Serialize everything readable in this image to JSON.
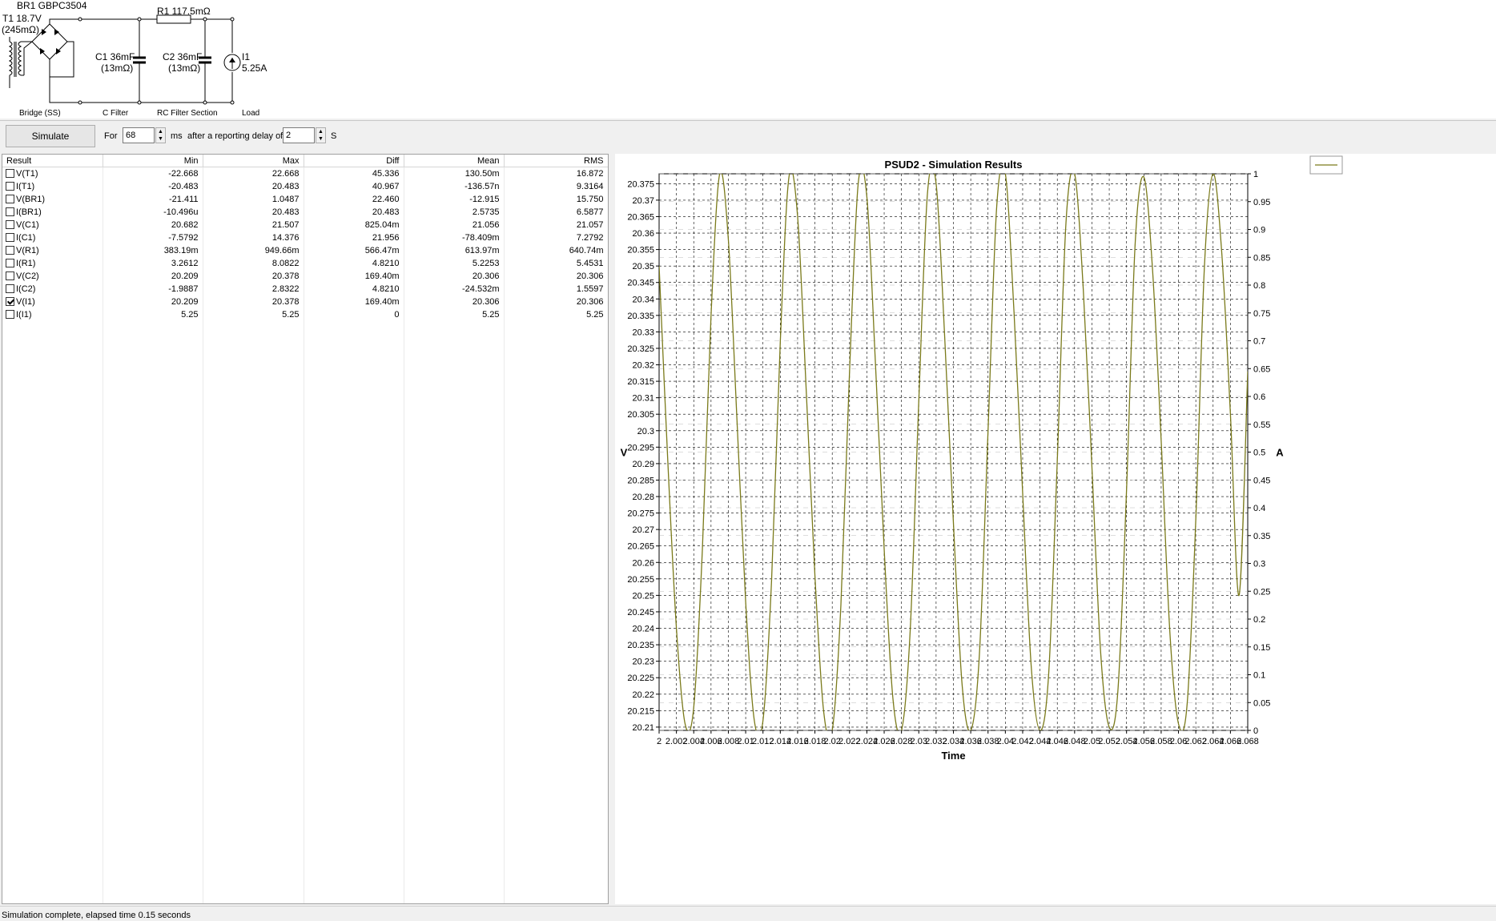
{
  "circuit": {
    "br1": "BR1 GBPC3504",
    "r1": "R1 117.5mΩ",
    "t1_line1": "T1 18.7V",
    "t1_line2": "(245mΩ)",
    "c1_line1": "C1 36mF",
    "c1_line2": "(13mΩ)",
    "c2_line1": "C2 36mF",
    "c2_line2": "(13mΩ)",
    "i1_line1": "I1",
    "i1_line2": "5.25A",
    "sections": [
      "Bridge (SS)",
      "C Filter",
      "RC Filter Section",
      "Load"
    ]
  },
  "controls": {
    "simulate_label": "Simulate",
    "for_label": "For",
    "duration_value": "68",
    "ms_label": "ms",
    "delay_label": "after a reporting delay of",
    "delay_value": "2",
    "s_label": "S"
  },
  "table": {
    "headers": [
      "Result",
      "Min",
      "Max",
      "Diff",
      "Mean",
      "RMS"
    ],
    "rows": [
      {
        "name": "V(T1)",
        "checked": false,
        "min": "-22.668",
        "max": "22.668",
        "diff": "45.336",
        "mean": "130.50m",
        "rms": "16.872"
      },
      {
        "name": "I(T1)",
        "checked": false,
        "min": "-20.483",
        "max": "20.483",
        "diff": "40.967",
        "mean": "-136.57n",
        "rms": "9.3164"
      },
      {
        "name": "V(BR1)",
        "checked": false,
        "min": "-21.411",
        "max": "1.0487",
        "diff": "22.460",
        "mean": "-12.915",
        "rms": "15.750"
      },
      {
        "name": "I(BR1)",
        "checked": false,
        "min": "-10.496u",
        "max": "20.483",
        "diff": "20.483",
        "mean": "2.5735",
        "rms": "6.5877"
      },
      {
        "name": "V(C1)",
        "checked": false,
        "min": "20.682",
        "max": "21.507",
        "diff": "825.04m",
        "mean": "21.056",
        "rms": "21.057"
      },
      {
        "name": "I(C1)",
        "checked": false,
        "min": "-7.5792",
        "max": "14.376",
        "diff": "21.956",
        "mean": "-78.409m",
        "rms": "7.2792"
      },
      {
        "name": "V(R1)",
        "checked": false,
        "min": "383.19m",
        "max": "949.66m",
        "diff": "566.47m",
        "mean": "613.97m",
        "rms": "640.74m"
      },
      {
        "name": "I(R1)",
        "checked": false,
        "min": "3.2612",
        "max": "8.0822",
        "diff": "4.8210",
        "mean": "5.2253",
        "rms": "5.4531"
      },
      {
        "name": "V(C2)",
        "checked": false,
        "min": "20.209",
        "max": "20.378",
        "diff": "169.40m",
        "mean": "20.306",
        "rms": "20.306"
      },
      {
        "name": "I(C2)",
        "checked": false,
        "min": "-1.9887",
        "max": "2.8322",
        "diff": "4.8210",
        "mean": "-24.532m",
        "rms": "1.5597"
      },
      {
        "name": "V(I1)",
        "checked": true,
        "min": "20.209",
        "max": "20.378",
        "diff": "169.40m",
        "mean": "20.306",
        "rms": "20.306"
      },
      {
        "name": "I(I1)",
        "checked": false,
        "min": "5.25",
        "max": "5.25",
        "diff": "0",
        "mean": "5.25",
        "rms": "5.25"
      }
    ]
  },
  "chart_data": {
    "type": "line",
    "title": "PSUD2 - Simulation Results",
    "xlabel": "Time",
    "ylabel": "V",
    "y2label": "A",
    "xlim": [
      2,
      2.068
    ],
    "ylim": [
      20.209,
      20.378
    ],
    "y2lim": [
      0,
      1
    ],
    "x_ticks": [
      "2",
      "2.002",
      "2.004",
      "2.006",
      "2.008",
      "2.01",
      "2.012",
      "2.014",
      "2.016",
      "2.018",
      "2.02",
      "2.022",
      "2.024",
      "2.026",
      "2.028",
      "2.03",
      "2.032",
      "2.034",
      "2.036",
      "2.038",
      "2.04",
      "2.042",
      "2.044",
      "2.046",
      "2.048",
      "2.05",
      "2.052",
      "2.054",
      "2.056",
      "2.058",
      "2.06",
      "2.062",
      "2.064",
      "2.066",
      "2.068"
    ],
    "y_ticks": [
      "20.375",
      "20.37",
      "20.365",
      "20.36",
      "20.355",
      "20.35",
      "20.345",
      "20.34",
      "20.335",
      "20.33",
      "20.325",
      "20.32",
      "20.315",
      "20.31",
      "20.305",
      "20.3",
      "20.295",
      "20.29",
      "20.285",
      "20.28",
      "20.275",
      "20.27",
      "20.265",
      "20.26",
      "20.255",
      "20.25",
      "20.245",
      "20.24",
      "20.235",
      "20.23",
      "20.225",
      "20.22",
      "20.215",
      "20.21"
    ],
    "y2_ticks": [
      "1",
      "0.95",
      "0.9",
      "0.85",
      "0.8",
      "0.75",
      "0.7",
      "0.65",
      "0.6",
      "0.55",
      "0.5",
      "0.45",
      "0.4",
      "0.35",
      "0.3",
      "0.25",
      "0.2",
      "0.15",
      "0.1",
      "0.05",
      "0"
    ],
    "grid": true,
    "series": [
      {
        "name": "V(I1)",
        "color": "#7a7a1a",
        "x": [
          2.0,
          2.001,
          2.002,
          2.003,
          2.004,
          2.005,
          2.006,
          2.007,
          2.008,
          2.009,
          2.01,
          2.011,
          2.012,
          2.013,
          2.014,
          2.015,
          2.016,
          2.017,
          2.018,
          2.019,
          2.02,
          2.021,
          2.022,
          2.023,
          2.024,
          2.025,
          2.026,
          2.027,
          2.028,
          2.029,
          2.03,
          2.031,
          2.032,
          2.033,
          2.034,
          2.035,
          2.036,
          2.037,
          2.038,
          2.039,
          2.04,
          2.041,
          2.042,
          2.043,
          2.044,
          2.045,
          2.046,
          2.047,
          2.048,
          2.049,
          2.05,
          2.051,
          2.052,
          2.053,
          2.054,
          2.055,
          2.056,
          2.057,
          2.058,
          2.059,
          2.06,
          2.061,
          2.062,
          2.063,
          2.064,
          2.065,
          2.066,
          2.067,
          2.068
        ],
        "y": [
          20.35,
          20.291,
          20.24,
          20.211,
          20.216,
          20.264,
          20.335,
          20.378,
          20.358,
          20.303,
          20.248,
          20.212,
          20.212,
          20.255,
          20.327,
          20.377,
          20.365,
          20.312,
          20.256,
          20.215,
          20.209,
          20.247,
          20.318,
          20.375,
          20.371,
          20.32,
          20.264,
          20.219,
          20.209,
          20.239,
          20.309,
          20.372,
          20.375,
          20.328,
          20.272,
          20.223,
          20.209,
          20.232,
          20.3,
          20.368,
          20.378,
          20.336,
          20.281,
          20.228,
          20.209,
          20.226,
          20.291,
          20.363,
          20.378,
          20.343,
          20.289,
          20.233,
          20.21,
          20.221,
          20.282,
          20.357,
          20.377,
          20.349,
          20.297,
          20.239,
          20.211,
          20.217,
          20.273,
          20.35,
          20.378,
          20.354,
          20.305,
          20.25,
          20.318
        ]
      }
    ]
  },
  "status": {
    "message": "Simulation complete, elapsed time 0.15 seconds"
  }
}
